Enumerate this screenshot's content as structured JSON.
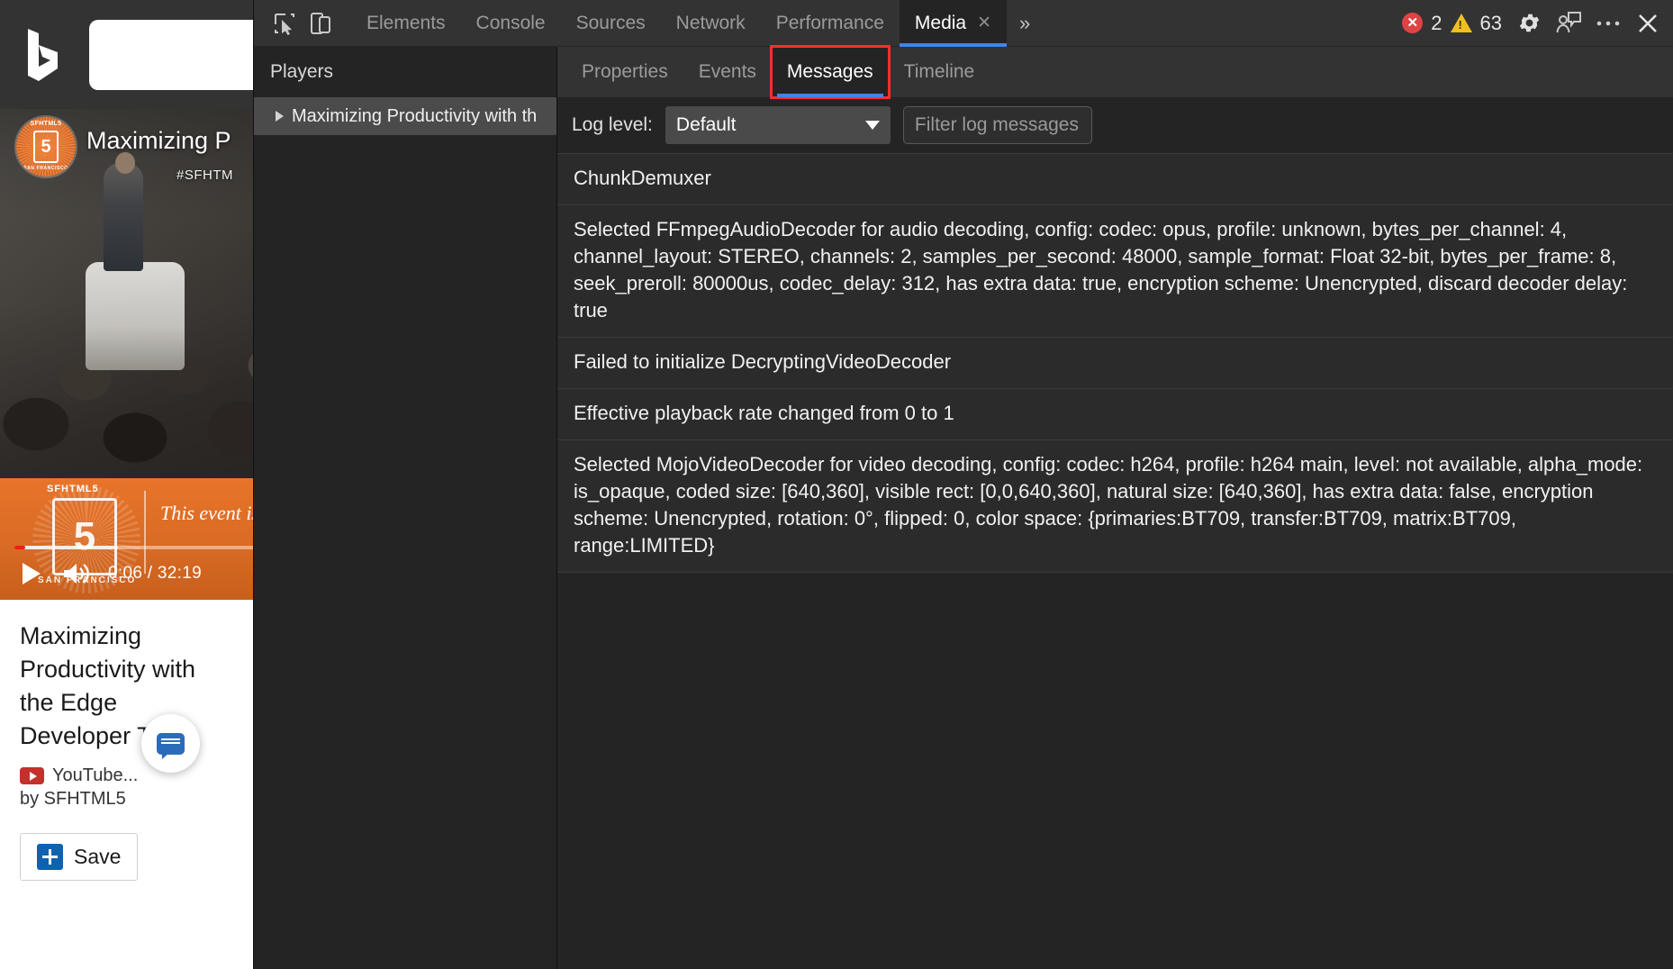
{
  "browser_page": {
    "logo_name": "bing-logo",
    "search_placeholder": "",
    "search_value": "",
    "video": {
      "overlay_title": "Maximizing P",
      "hashtag": "#SFHTM",
      "banner_top_text": "SFHTML5",
      "banner_number": "5",
      "banner_sub_text": "SAN FRANCISCO",
      "banner_script": "This event is",
      "badge_top_text": "SFHTML5",
      "badge_number": "5",
      "badge_bottom_text": "SAN FRANCISCO",
      "current_time": "0:06",
      "duration": "32:19",
      "time_display": "0:06 / 32:19",
      "play_icon": "play-icon",
      "volume_icon": "volume-icon",
      "progress_percent": 4,
      "buffered_percent": 38
    },
    "info": {
      "title": "Maximizing Productivity with the Edge Developer Tools",
      "source": "YouTube...",
      "byline": "by SFHTML5",
      "save_label": "Save",
      "save_icon": "add-to-collections-icon",
      "chat_icon": "chat-bubble-icon"
    }
  },
  "devtools": {
    "toolbar": {
      "inspect_icon": "inspect-element-icon",
      "device_icon": "device-emulation-icon",
      "tabs": [
        {
          "label": "Elements",
          "active": false,
          "closable": false
        },
        {
          "label": "Console",
          "active": false,
          "closable": false
        },
        {
          "label": "Sources",
          "active": false,
          "closable": false
        },
        {
          "label": "Network",
          "active": false,
          "closable": false
        },
        {
          "label": "Performance",
          "active": false,
          "closable": false
        },
        {
          "label": "Media",
          "active": true,
          "closable": true
        }
      ],
      "more_tabs_label": "»",
      "error_count": "2",
      "warning_count": "63",
      "settings_icon": "gear-icon",
      "feedback_icon": "feedback-icon",
      "more_options_icon": "more-options-icon",
      "close_icon": "close-icon"
    },
    "players_pane": {
      "header": "Players",
      "items": [
        {
          "label": "Maximizing Productivity with th",
          "expanded": false,
          "selected": true
        }
      ]
    },
    "media_pane": {
      "sub_tabs": [
        {
          "label": "Properties",
          "active": false,
          "highlighted": false
        },
        {
          "label": "Events",
          "active": false,
          "highlighted": false
        },
        {
          "label": "Messages",
          "active": true,
          "highlighted": true
        },
        {
          "label": "Timeline",
          "active": false,
          "highlighted": false
        }
      ],
      "log_level_label": "Log level:",
      "log_level_value": "Default",
      "filter_placeholder": "Filter log messages",
      "filter_value": "",
      "messages": [
        {
          "text": "ChunkDemuxer"
        },
        {
          "text": "Selected FFmpegAudioDecoder for audio decoding, config: codec: opus, profile: unknown, bytes_per_channel: 4, channel_layout: STEREO, channels: 2, samples_per_second: 48000, sample_format: Float 32-bit, bytes_per_frame: 8, seek_preroll: 80000us, codec_delay: 312, has extra data: true, encryption scheme: Unencrypted, discard decoder delay: true"
        },
        {
          "text": "Failed to initialize DecryptingVideoDecoder"
        },
        {
          "text": "Effective playback rate changed from 0 to 1"
        },
        {
          "text": "Selected MojoVideoDecoder for video decoding, config: codec: h264, profile: h264 main, level: not available, alpha_mode: is_opaque, coded size: [640,360], visible rect: [0,0,640,360], natural size: [640,360], has extra data: false, encryption scheme: Unencrypted, rotation: 0°, flipped: 0, color space: {primaries:BT709, transfer:BT709, matrix:BT709, range:LIMITED}"
        }
      ]
    }
  },
  "colors": {
    "accent_blue": "#4285e8",
    "highlight_red": "#ff2d2d",
    "error_red": "#e04343",
    "warning_yellow": "#f0c020",
    "devtools_bg": "#242424",
    "toolbar_bg": "#333333"
  }
}
